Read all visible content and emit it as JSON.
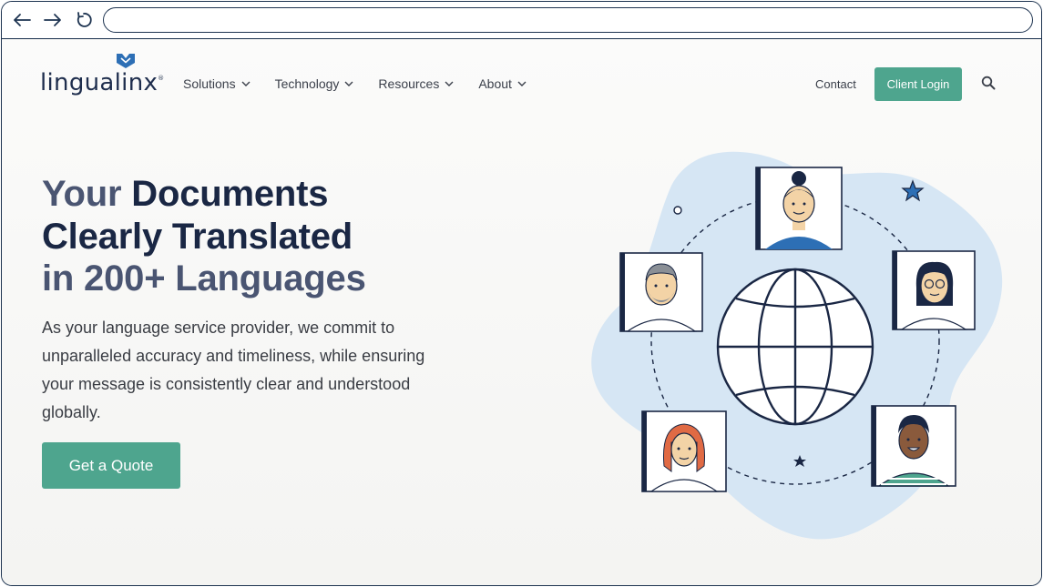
{
  "browser": {
    "back_icon": "arrow-left-icon",
    "forward_icon": "arrow-right-icon",
    "reload_icon": "reload-icon",
    "url": ""
  },
  "brand": {
    "name": "lingualinx",
    "trademark": "®"
  },
  "nav": {
    "items": [
      {
        "label": "Solutions"
      },
      {
        "label": "Technology"
      },
      {
        "label": "Resources"
      },
      {
        "label": "About"
      }
    ],
    "contact": "Contact",
    "client_login": "Client Login"
  },
  "hero": {
    "headline_part1": "Your",
    "headline_part2": " Documents",
    "headline_line2": "Clearly Translated",
    "headline_line3": "in 200+ Languages",
    "lead": "As your language service provider, we commit to unparalleled accuracy and timeliness, while ensuring your message is consistently clear and understood globally.",
    "cta": "Get a Quote"
  },
  "colors": {
    "accent": "#4ea58e",
    "navy": "#1a2744",
    "blob": "#d6e6f4"
  }
}
